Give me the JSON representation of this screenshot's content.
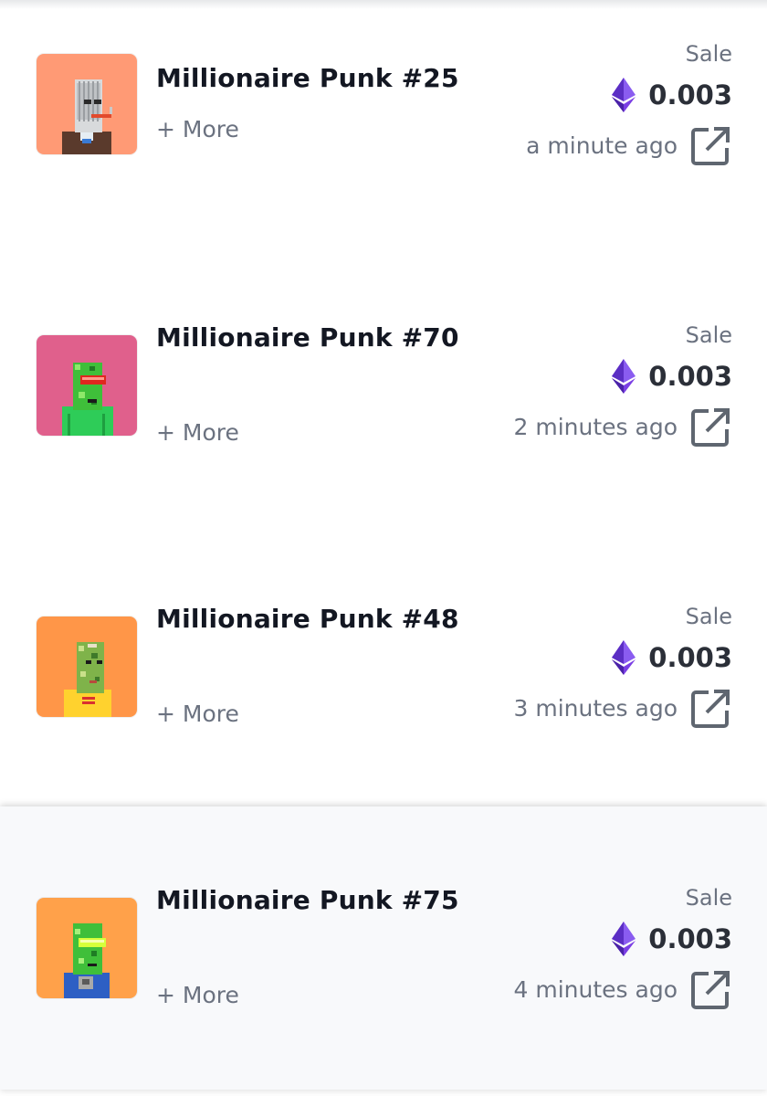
{
  "icons": {
    "currency": "ethereum-icon",
    "link": "external-link-icon"
  },
  "colors": {
    "eth_purple": "#7b3fe4",
    "title": "#131722",
    "muted": "#6b7280"
  },
  "sales": [
    {
      "title": "Millionaire Punk #25",
      "more": "+ More",
      "type": "Sale",
      "price": "0.003",
      "time": "a minute ago",
      "thumb_bg": "#ff9a75"
    },
    {
      "title": "Millionaire Punk #70",
      "more": "+ More",
      "type": "Sale",
      "price": "0.003",
      "time": "2 minutes ago",
      "thumb_bg": "#e0608c"
    },
    {
      "title": "Millionaire Punk #48",
      "more": "+ More",
      "type": "Sale",
      "price": "0.003",
      "time": "3 minutes ago",
      "thumb_bg": "#ff9648"
    },
    {
      "title": "Millionaire Punk #75",
      "more": "+ More",
      "type": "Sale",
      "price": "0.003",
      "time": "4 minutes ago",
      "thumb_bg": "#ffa14a"
    }
  ]
}
